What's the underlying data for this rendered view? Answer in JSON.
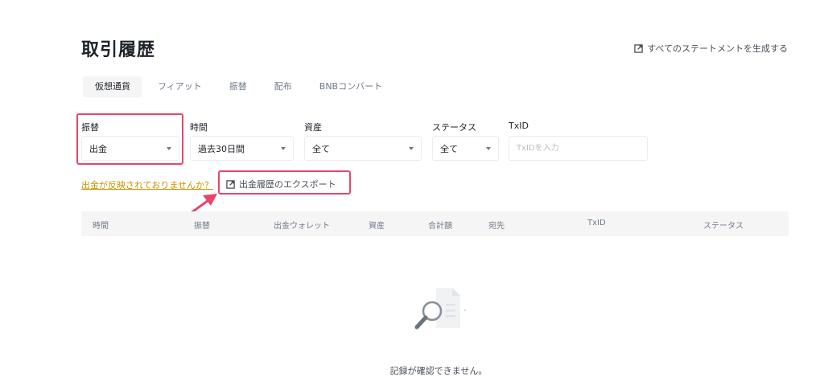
{
  "page": {
    "title": "取引履歴",
    "statements_link": "すべてのステートメントを生成する"
  },
  "tabs": [
    {
      "label": "仮想通貨",
      "active": true
    },
    {
      "label": "フィアット",
      "active": false
    },
    {
      "label": "振替",
      "active": false
    },
    {
      "label": "配布",
      "active": false
    },
    {
      "label": "BNBコンバート",
      "active": false
    }
  ],
  "filters": {
    "transfer": {
      "label": "振替",
      "value": "出金"
    },
    "time": {
      "label": "時間",
      "value": "過去30日間"
    },
    "asset": {
      "label": "資産",
      "value": "全て"
    },
    "status": {
      "label": "ステータス",
      "value": "全て"
    },
    "txid": {
      "label": "TxID",
      "placeholder": "TxIDを入力"
    }
  },
  "links": {
    "help": "出金が反映されておりませんか？",
    "export": "出金履歴のエクスポート"
  },
  "table": {
    "columns": [
      "時間",
      "振替",
      "出金ウォレット",
      "資産",
      "合計額",
      "宛先",
      "TxID",
      "ステータス"
    ]
  },
  "empty_state": {
    "icon": "magnifier-document-icon",
    "message": "記録が確認できません。"
  },
  "colors": {
    "highlight": "#e9456b",
    "link_gold": "#c99400",
    "header_bg": "#f5f5f5",
    "border": "#eaecef"
  }
}
